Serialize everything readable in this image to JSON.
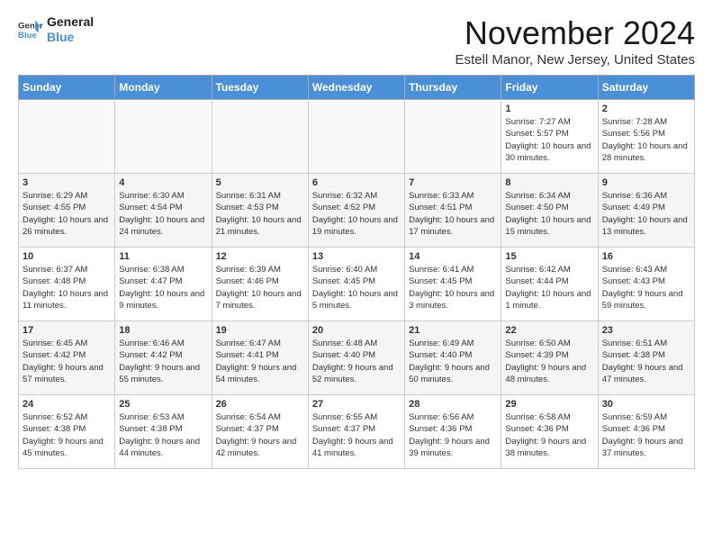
{
  "logo": {
    "line1": "General",
    "line2": "Blue"
  },
  "title": "November 2024",
  "location": "Estell Manor, New Jersey, United States",
  "weekdays": [
    "Sunday",
    "Monday",
    "Tuesday",
    "Wednesday",
    "Thursday",
    "Friday",
    "Saturday"
  ],
  "weeks": [
    [
      {
        "day": "",
        "sunrise": "",
        "sunset": "",
        "daylight": ""
      },
      {
        "day": "",
        "sunrise": "",
        "sunset": "",
        "daylight": ""
      },
      {
        "day": "",
        "sunrise": "",
        "sunset": "",
        "daylight": ""
      },
      {
        "day": "",
        "sunrise": "",
        "sunset": "",
        "daylight": ""
      },
      {
        "day": "",
        "sunrise": "",
        "sunset": "",
        "daylight": ""
      },
      {
        "day": "1",
        "sunrise": "Sunrise: 7:27 AM",
        "sunset": "Sunset: 5:57 PM",
        "daylight": "Daylight: 10 hours and 30 minutes."
      },
      {
        "day": "2",
        "sunrise": "Sunrise: 7:28 AM",
        "sunset": "Sunset: 5:56 PM",
        "daylight": "Daylight: 10 hours and 28 minutes."
      }
    ],
    [
      {
        "day": "3",
        "sunrise": "Sunrise: 6:29 AM",
        "sunset": "Sunset: 4:55 PM",
        "daylight": "Daylight: 10 hours and 26 minutes."
      },
      {
        "day": "4",
        "sunrise": "Sunrise: 6:30 AM",
        "sunset": "Sunset: 4:54 PM",
        "daylight": "Daylight: 10 hours and 24 minutes."
      },
      {
        "day": "5",
        "sunrise": "Sunrise: 6:31 AM",
        "sunset": "Sunset: 4:53 PM",
        "daylight": "Daylight: 10 hours and 21 minutes."
      },
      {
        "day": "6",
        "sunrise": "Sunrise: 6:32 AM",
        "sunset": "Sunset: 4:52 PM",
        "daylight": "Daylight: 10 hours and 19 minutes."
      },
      {
        "day": "7",
        "sunrise": "Sunrise: 6:33 AM",
        "sunset": "Sunset: 4:51 PM",
        "daylight": "Daylight: 10 hours and 17 minutes."
      },
      {
        "day": "8",
        "sunrise": "Sunrise: 6:34 AM",
        "sunset": "Sunset: 4:50 PM",
        "daylight": "Daylight: 10 hours and 15 minutes."
      },
      {
        "day": "9",
        "sunrise": "Sunrise: 6:36 AM",
        "sunset": "Sunset: 4:49 PM",
        "daylight": "Daylight: 10 hours and 13 minutes."
      }
    ],
    [
      {
        "day": "10",
        "sunrise": "Sunrise: 6:37 AM",
        "sunset": "Sunset: 4:48 PM",
        "daylight": "Daylight: 10 hours and 11 minutes."
      },
      {
        "day": "11",
        "sunrise": "Sunrise: 6:38 AM",
        "sunset": "Sunset: 4:47 PM",
        "daylight": "Daylight: 10 hours and 9 minutes."
      },
      {
        "day": "12",
        "sunrise": "Sunrise: 6:39 AM",
        "sunset": "Sunset: 4:46 PM",
        "daylight": "Daylight: 10 hours and 7 minutes."
      },
      {
        "day": "13",
        "sunrise": "Sunrise: 6:40 AM",
        "sunset": "Sunset: 4:45 PM",
        "daylight": "Daylight: 10 hours and 5 minutes."
      },
      {
        "day": "14",
        "sunrise": "Sunrise: 6:41 AM",
        "sunset": "Sunset: 4:45 PM",
        "daylight": "Daylight: 10 hours and 3 minutes."
      },
      {
        "day": "15",
        "sunrise": "Sunrise: 6:42 AM",
        "sunset": "Sunset: 4:44 PM",
        "daylight": "Daylight: 10 hours and 1 minute."
      },
      {
        "day": "16",
        "sunrise": "Sunrise: 6:43 AM",
        "sunset": "Sunset: 4:43 PM",
        "daylight": "Daylight: 9 hours and 59 minutes."
      }
    ],
    [
      {
        "day": "17",
        "sunrise": "Sunrise: 6:45 AM",
        "sunset": "Sunset: 4:42 PM",
        "daylight": "Daylight: 9 hours and 57 minutes."
      },
      {
        "day": "18",
        "sunrise": "Sunrise: 6:46 AM",
        "sunset": "Sunset: 4:42 PM",
        "daylight": "Daylight: 9 hours and 55 minutes."
      },
      {
        "day": "19",
        "sunrise": "Sunrise: 6:47 AM",
        "sunset": "Sunset: 4:41 PM",
        "daylight": "Daylight: 9 hours and 54 minutes."
      },
      {
        "day": "20",
        "sunrise": "Sunrise: 6:48 AM",
        "sunset": "Sunset: 4:40 PM",
        "daylight": "Daylight: 9 hours and 52 minutes."
      },
      {
        "day": "21",
        "sunrise": "Sunrise: 6:49 AM",
        "sunset": "Sunset: 4:40 PM",
        "daylight": "Daylight: 9 hours and 50 minutes."
      },
      {
        "day": "22",
        "sunrise": "Sunrise: 6:50 AM",
        "sunset": "Sunset: 4:39 PM",
        "daylight": "Daylight: 9 hours and 48 minutes."
      },
      {
        "day": "23",
        "sunrise": "Sunrise: 6:51 AM",
        "sunset": "Sunset: 4:38 PM",
        "daylight": "Daylight: 9 hours and 47 minutes."
      }
    ],
    [
      {
        "day": "24",
        "sunrise": "Sunrise: 6:52 AM",
        "sunset": "Sunset: 4:38 PM",
        "daylight": "Daylight: 9 hours and 45 minutes."
      },
      {
        "day": "25",
        "sunrise": "Sunrise: 6:53 AM",
        "sunset": "Sunset: 4:38 PM",
        "daylight": "Daylight: 9 hours and 44 minutes."
      },
      {
        "day": "26",
        "sunrise": "Sunrise: 6:54 AM",
        "sunset": "Sunset: 4:37 PM",
        "daylight": "Daylight: 9 hours and 42 minutes."
      },
      {
        "day": "27",
        "sunrise": "Sunrise: 6:55 AM",
        "sunset": "Sunset: 4:37 PM",
        "daylight": "Daylight: 9 hours and 41 minutes."
      },
      {
        "day": "28",
        "sunrise": "Sunrise: 6:56 AM",
        "sunset": "Sunset: 4:36 PM",
        "daylight": "Daylight: 9 hours and 39 minutes."
      },
      {
        "day": "29",
        "sunrise": "Sunrise: 6:58 AM",
        "sunset": "Sunset: 4:36 PM",
        "daylight": "Daylight: 9 hours and 38 minutes."
      },
      {
        "day": "30",
        "sunrise": "Sunrise: 6:59 AM",
        "sunset": "Sunset: 4:36 PM",
        "daylight": "Daylight: 9 hours and 37 minutes."
      }
    ]
  ]
}
